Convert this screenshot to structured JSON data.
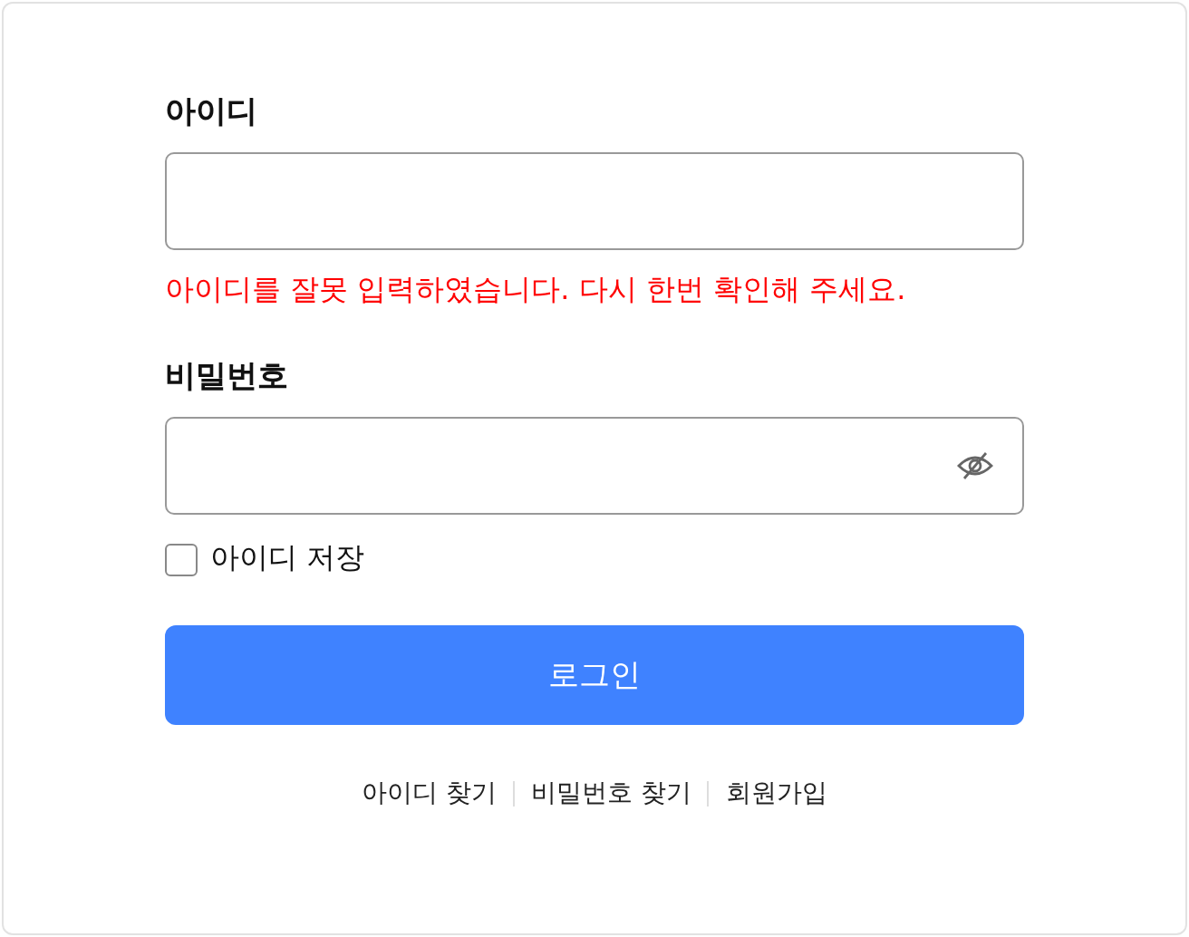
{
  "id_field": {
    "label": "아이디",
    "error": "아이디를 잘못 입력하였습니다. 다시 한번 확인해 주세요."
  },
  "password_field": {
    "label": "비밀번호",
    "password_visible": false
  },
  "remember_id": {
    "label": "아이디 저장",
    "checked": false
  },
  "login_button": {
    "label": "로그인"
  },
  "links": [
    "아이디 찾기",
    "비밀번호 찾기",
    "회원가입"
  ]
}
